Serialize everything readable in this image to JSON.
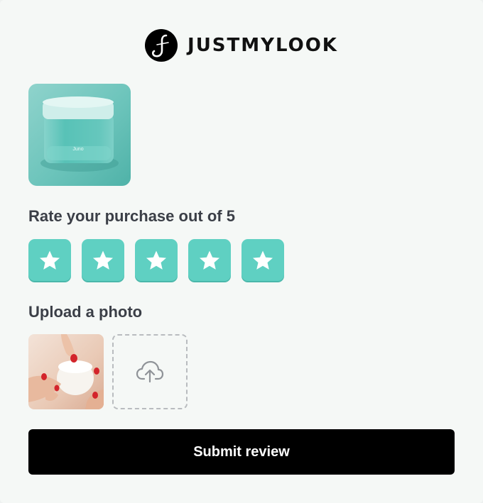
{
  "brand": {
    "name": "JUSTMYLOOK",
    "logo_icon": "signature-j-logo-icon"
  },
  "product": {
    "image_alt": "product-jar-image",
    "jar_label": "Juno"
  },
  "rating": {
    "label": "Rate your purchase out of 5",
    "max": 5,
    "value": 5,
    "star_color": "#5fd0c2",
    "icon": "star-icon"
  },
  "upload": {
    "label": "Upload a photo",
    "uploaded_count": 1,
    "upload_icon": "cloud-upload-icon"
  },
  "submit": {
    "label": "Submit review"
  }
}
